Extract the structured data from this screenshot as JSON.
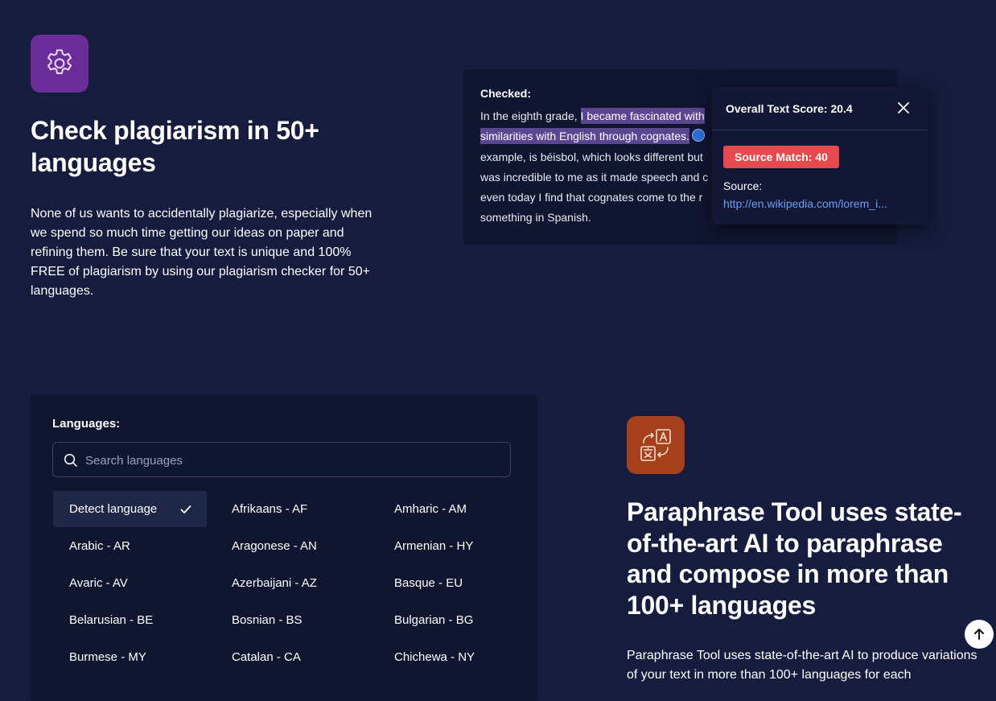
{
  "feature1": {
    "icon": "gear-icon",
    "heading": "Check plagiarism in 50+ languages",
    "description": "None of us wants to accidentally plagiarize, especially when we spend so much time getting our ideas on paper and refining them. Be sure that your text is unique and 100% FREE of plagiarism by using our plagiarism checker for 50+ languages."
  },
  "checked": {
    "title": "Checked:",
    "line1_plain": "In the eighth grade, ",
    "line1_highlight": "I became fascinated with",
    "line2_highlight": "similarities with English through cognates.",
    "line3": "example, is béisbol, which looks different but",
    "line4": "was incredible to me as it made speech and c",
    "line5": "even today I find that cognates come to the r",
    "line6": "something in Spanish."
  },
  "popup": {
    "title": "Overall Text Score: 20.4",
    "match_badge": "Source Match: 40",
    "source_label": "Source:",
    "source_link": "http://en.wikipedia.com/lorem_i..."
  },
  "languages": {
    "title": "Languages:",
    "search_placeholder": "Search languages",
    "items": [
      "Detect language",
      "Afrikaans - AF",
      "Amharic - AM",
      "Arabic - AR",
      "Aragonese - AN",
      "Armenian - HY",
      "Avaric - AV",
      "Azerbaijani - AZ",
      "Basque - EU",
      "Belarusian - BE",
      "Bosnian - BS",
      "Bulgarian - BG",
      "Burmese - MY",
      "Catalan - CA",
      "Chichewa - NY"
    ],
    "selected": "Detect language"
  },
  "feature2": {
    "icon": "translate-icon",
    "heading": "Paraphrase Tool uses state-of-the-art AI to paraphrase and compose in more than 100+ languages",
    "description": "Paraphrase Tool uses state-of-the-art AI to produce variations of your text in more than 100+ languages for each"
  },
  "colors": {
    "background": "#151c3d",
    "gear_tile": "#6a2c96",
    "translate_tile": "#a5401d",
    "match_badge": "#e5484d",
    "highlight": "#5b4691",
    "link": "#6f9ff5"
  }
}
